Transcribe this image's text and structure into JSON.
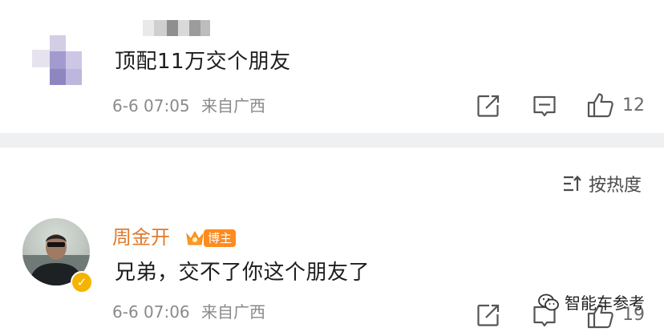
{
  "comments": [
    {
      "text": "顶配11万交个朋友",
      "time": "6-6 07:05",
      "location": "来自广西",
      "likes": "12"
    },
    {
      "author": "周金开",
      "badge": "博主",
      "text": "兄弟，交不了你这个朋友了",
      "time": "6-6 07:06",
      "location": "来自广西",
      "likes": "19"
    }
  ],
  "sort": {
    "label": "按热度",
    "icon": "sort-icon"
  },
  "watermark": {
    "text": "智能车参考",
    "icon": "wechat-icon"
  },
  "icons": {
    "share": "share-icon",
    "comment": "comment-icon",
    "like": "like-icon",
    "verified": "verified-icon",
    "blogger": "crown-icon"
  },
  "colors": {
    "author_name": "#e07a2d",
    "badge_bg": "#ff8a1e",
    "verified": "#f4b400",
    "divider": "#eef0f2"
  }
}
